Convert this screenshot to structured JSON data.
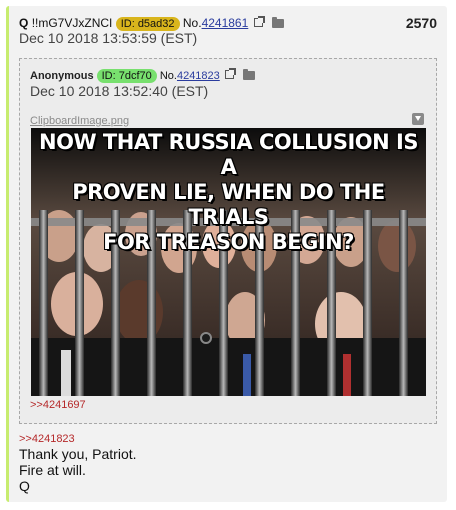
{
  "post": {
    "name": "Q",
    "tripcode": "!!mG7VJxZNCI",
    "id_label": "ID: d5ad32",
    "no_prefix": "No.",
    "no": "4241861",
    "date": "Dec 10 2018 13:53:59 (EST)",
    "count": "2570",
    "reply_ref": ">>4241823",
    "message_lines": [
      "Thank you, Patriot.",
      "Fire at will.",
      "Q"
    ]
  },
  "quote": {
    "name": "Anonymous",
    "id_label": "ID: 7dcf70",
    "no_prefix": "No.",
    "no": "4241823",
    "date": "Dec 10 2018 13:52:40 (EST)",
    "filename": "ClipboardImage.png",
    "image_caption_lines": [
      "NOW THAT RUSSIA COLLUSION IS A",
      "PROVEN LIE, WHEN DO THE TRIALS",
      "FOR TREASON BEGIN?"
    ],
    "backlink": ">>4241697"
  },
  "colors": {
    "post_bg": "#f2f2f2",
    "accent_border": "#c7ec6f",
    "id_gold": "#d9b51c",
    "id_green": "#78e06e",
    "link": "#2a3c9e",
    "quote_link": "#b5292a"
  },
  "icons": {
    "external": "external-link-icon",
    "folder": "folder-icon",
    "download": "download-icon"
  }
}
